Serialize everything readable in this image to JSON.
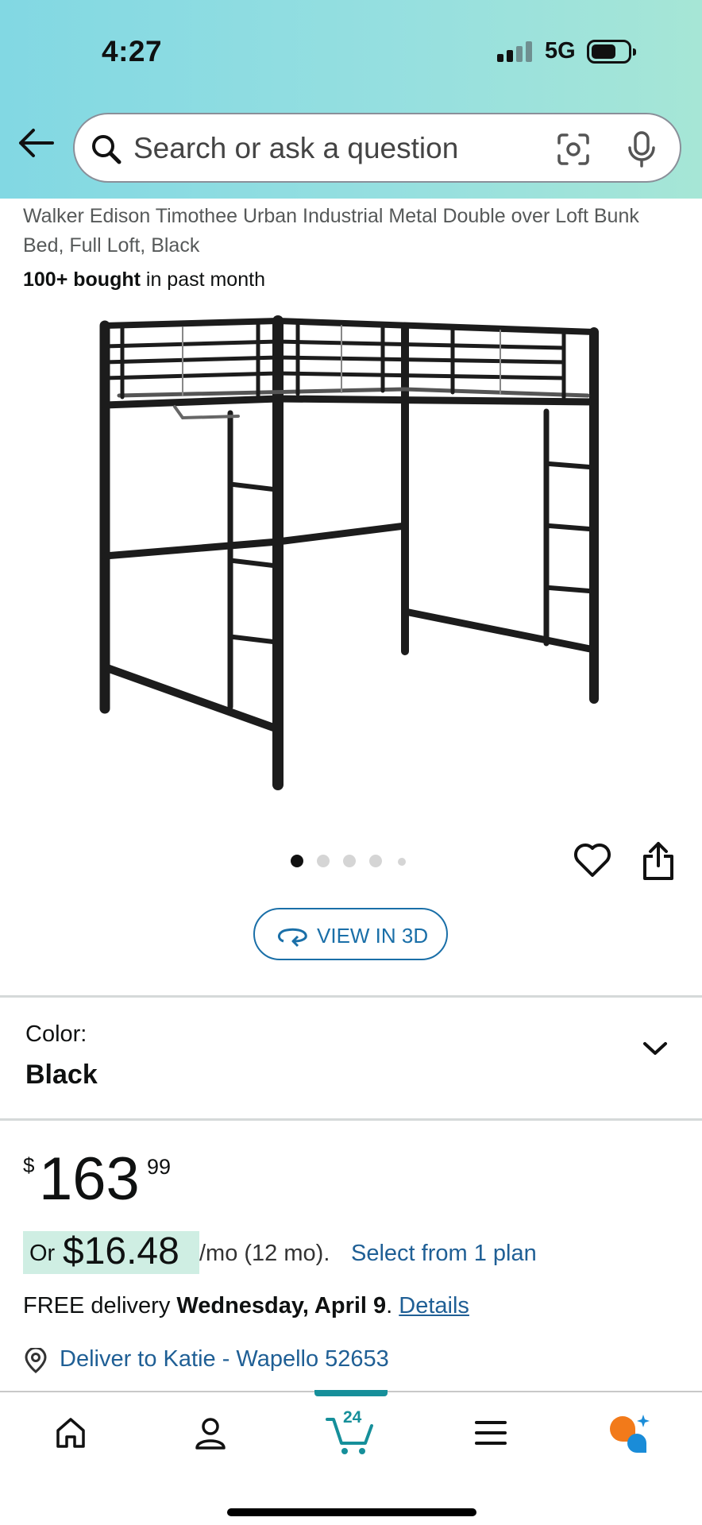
{
  "status_bar": {
    "time": "4:27",
    "network": "5G"
  },
  "search": {
    "placeholder": "Search or ask a question"
  },
  "product": {
    "title": "Walker Edison Timothee Urban Industrial Metal Double over Loft Bunk Bed, Full Loft, Black",
    "bought_bold": "100+ bought",
    "bought_rest": " in past month",
    "image_icon": "loft-bed-image",
    "image_count": 5,
    "active_image": 1
  },
  "view3d": {
    "label": "VIEW IN 3D"
  },
  "color": {
    "label": "Color:",
    "value": "Black"
  },
  "price": {
    "currency": "$",
    "whole": "163",
    "fraction": "99"
  },
  "monthly": {
    "or": "Or",
    "amount": "$16.48",
    "term": "/mo (12 mo).",
    "plan_link": "Select from 1 plan"
  },
  "delivery": {
    "prefix": "FREE delivery",
    "date": "Wednesday, April 9",
    "period": ".",
    "details_link": "Details"
  },
  "location": {
    "text": "Deliver to Katie - Wapello 52653"
  },
  "bottom_nav": {
    "cart_count": "24",
    "items": [
      "home-icon",
      "account-icon",
      "cart-icon",
      "menu-icon",
      "rufus-ai-icon"
    ]
  },
  "colors": {
    "link": "#1f5f95",
    "accent": "#168f9a",
    "highlight": "#cfeee3"
  }
}
